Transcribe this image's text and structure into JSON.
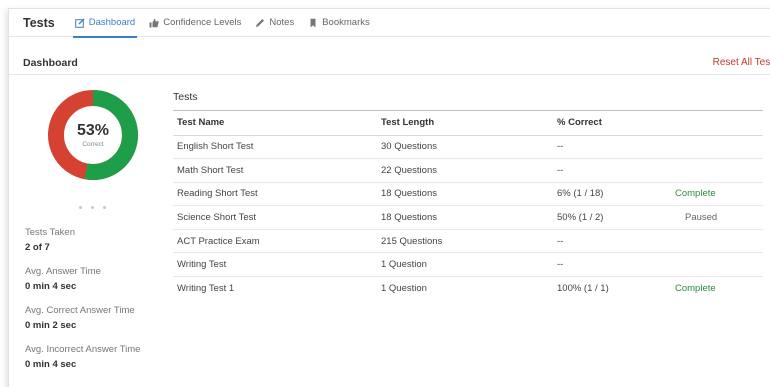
{
  "header": {
    "title": "Tests",
    "tabs": [
      {
        "label": "Dashboard",
        "icon": "edit-icon",
        "active": true
      },
      {
        "label": "Confidence Levels",
        "icon": "thumbs-up-icon",
        "active": false
      },
      {
        "label": "Notes",
        "icon": "pencil-icon",
        "active": false
      },
      {
        "label": "Bookmarks",
        "icon": "bookmark-icon",
        "active": false
      }
    ]
  },
  "section": {
    "title": "Dashboard",
    "reset_label": "Reset All Tests"
  },
  "summary": {
    "percent_label": "53%",
    "percent_sub": "Correct",
    "percent_value": 53,
    "colors": {
      "correct": "#1e9e48",
      "incorrect": "#d64232"
    }
  },
  "stats": [
    {
      "label": "Tests Taken",
      "value": "2 of 7"
    },
    {
      "label": "Avg. Answer Time",
      "value": "0 min 4 sec"
    },
    {
      "label": "Avg. Correct Answer Time",
      "value": "0 min 2 sec"
    },
    {
      "label": "Avg. Incorrect Answer Time",
      "value": "0 min 4 sec"
    }
  ],
  "tests": {
    "heading": "Tests",
    "columns": [
      "Test Name",
      "Test Length",
      "% Correct",
      ""
    ],
    "rows": [
      {
        "name": "English Short Test",
        "length": "30 Questions",
        "pct": "--",
        "status": ""
      },
      {
        "name": "Math Short Test",
        "length": "22 Questions",
        "pct": "--",
        "status": ""
      },
      {
        "name": "Reading Short Test",
        "length": "18 Questions",
        "pct": "6% (1 / 18)",
        "status": "Complete"
      },
      {
        "name": "Science Short Test",
        "length": "18 Questions",
        "pct": "50% (1 / 2)",
        "status": "Paused"
      },
      {
        "name": "ACT Practice Exam",
        "length": "215 Questions",
        "pct": "--",
        "status": ""
      },
      {
        "name": "Writing Test",
        "length": "1 Question",
        "pct": "--",
        "status": ""
      },
      {
        "name": "Writing Test 1",
        "length": "1 Question",
        "pct": "100% (1 / 1)",
        "status": "Complete"
      }
    ]
  }
}
